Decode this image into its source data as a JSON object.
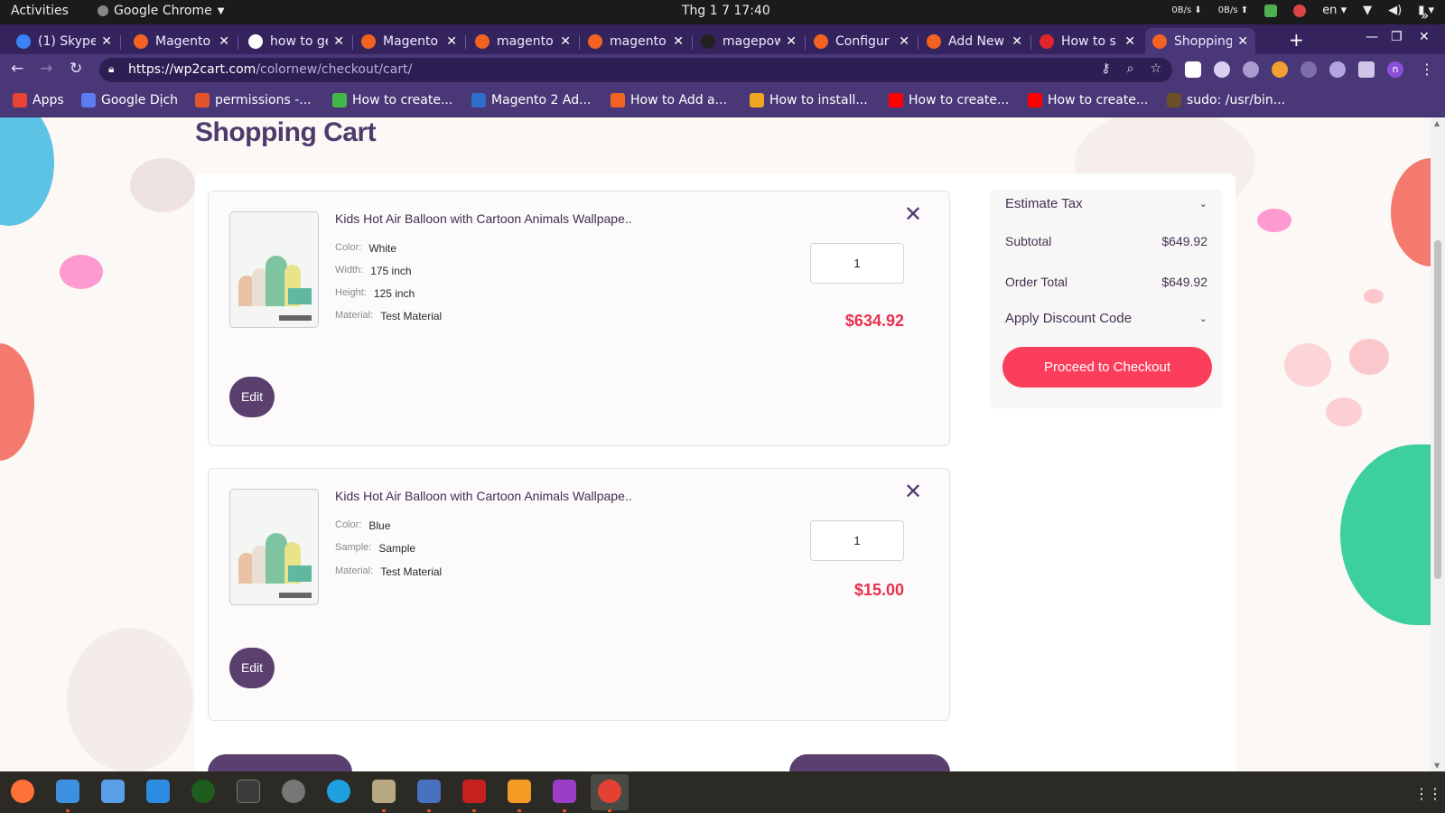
{
  "system_bar": {
    "activities": "Activities",
    "app_name": "Google Chrome",
    "clock": "Thg 1 7  17:40",
    "net_down": "0B/s",
    "net_up": "0B/s",
    "lang": "en"
  },
  "browser": {
    "tabs": [
      {
        "title": "(1) Skype",
        "icon": "skype-icon",
        "color": "#3b82f6",
        "active": false
      },
      {
        "title": "Magento",
        "icon": "magento-icon",
        "color": "#f26322",
        "active": false
      },
      {
        "title": "how to ge",
        "icon": "google-icon",
        "color": "#ffffff",
        "active": false
      },
      {
        "title": "Magento",
        "icon": "magento-icon",
        "color": "#f26322",
        "active": false
      },
      {
        "title": "magento",
        "icon": "magento-cube-icon",
        "color": "#f26322",
        "active": false
      },
      {
        "title": "magento",
        "icon": "magento-cube-icon",
        "color": "#f26322",
        "active": false
      },
      {
        "title": "magepow",
        "icon": "github-icon",
        "color": "#222222",
        "active": false
      },
      {
        "title": "Configur",
        "icon": "magento-icon",
        "color": "#f26322",
        "active": false
      },
      {
        "title": "Add New",
        "icon": "magento-icon",
        "color": "#f26322",
        "active": false
      },
      {
        "title": "How to s",
        "icon": "h-icon",
        "color": "#e3262e",
        "active": false
      },
      {
        "title": "Shopping",
        "icon": "magento-icon",
        "color": "#f26322",
        "active": true
      }
    ],
    "url_host": "https://wp2cart.com",
    "url_path": "/colornew/checkout/cart/",
    "bookmarks": [
      {
        "label": "Apps",
        "icon": "apps-grid-icon",
        "color": "#e94335"
      },
      {
        "label": "Google Dịch",
        "icon": "translate-icon",
        "color": "#5b7cf0"
      },
      {
        "label": "permissions -...",
        "icon": "askubuntu-icon",
        "color": "#e2542b"
      },
      {
        "label": "How to create...",
        "icon": "qa-icon",
        "color": "#42b649"
      },
      {
        "label": "Magento 2 Ad...",
        "icon": "mountain-icon",
        "color": "#2f6ec9"
      },
      {
        "label": "How to Add a...",
        "icon": "magento-icon",
        "color": "#f26322"
      },
      {
        "label": "How to install...",
        "icon": "arrow-icon",
        "color": "#f2a51f"
      },
      {
        "label": "How to create...",
        "icon": "youtube-icon",
        "color": "#ff0000"
      },
      {
        "label": "How to create...",
        "icon": "youtube-icon",
        "color": "#ff0000"
      },
      {
        "label": "sudo: /usr/bin...",
        "icon": "avatar-icon",
        "color": "#6b4f2a"
      }
    ]
  },
  "page": {
    "title": "Shopping Cart",
    "items": [
      {
        "name": "Kids Hot Air Balloon with Cartoon Animals Wallpape..",
        "options": [
          {
            "label": "Color:",
            "value": "White"
          },
          {
            "label": "Width:",
            "value": "175 inch"
          },
          {
            "label": "Height:",
            "value": "125 inch"
          },
          {
            "label": "Material:",
            "value": "Test Material"
          }
        ],
        "qty": "1",
        "price": "$634.92",
        "edit_label": "Edit"
      },
      {
        "name": "Kids Hot Air Balloon with Cartoon Animals Wallpape..",
        "options": [
          {
            "label": "Color:",
            "value": "Blue"
          },
          {
            "label": "Sample:",
            "value": "Sample"
          },
          {
            "label": "Material:",
            "value": "Test Material"
          }
        ],
        "qty": "1",
        "price": "$15.00",
        "edit_label": "Edit"
      }
    ],
    "summary": {
      "estimate_tax": "Estimate Tax",
      "subtotal_label": "Subtotal",
      "subtotal_value": "$649.92",
      "order_total_label": "Order Total",
      "order_total_value": "$649.92",
      "discount_label": "Apply Discount Code",
      "checkout_label": "Proceed to Checkout"
    },
    "colors": {
      "accent": "#fb3e5c",
      "primary": "#5b3f6e",
      "price": "#e8314e"
    }
  }
}
